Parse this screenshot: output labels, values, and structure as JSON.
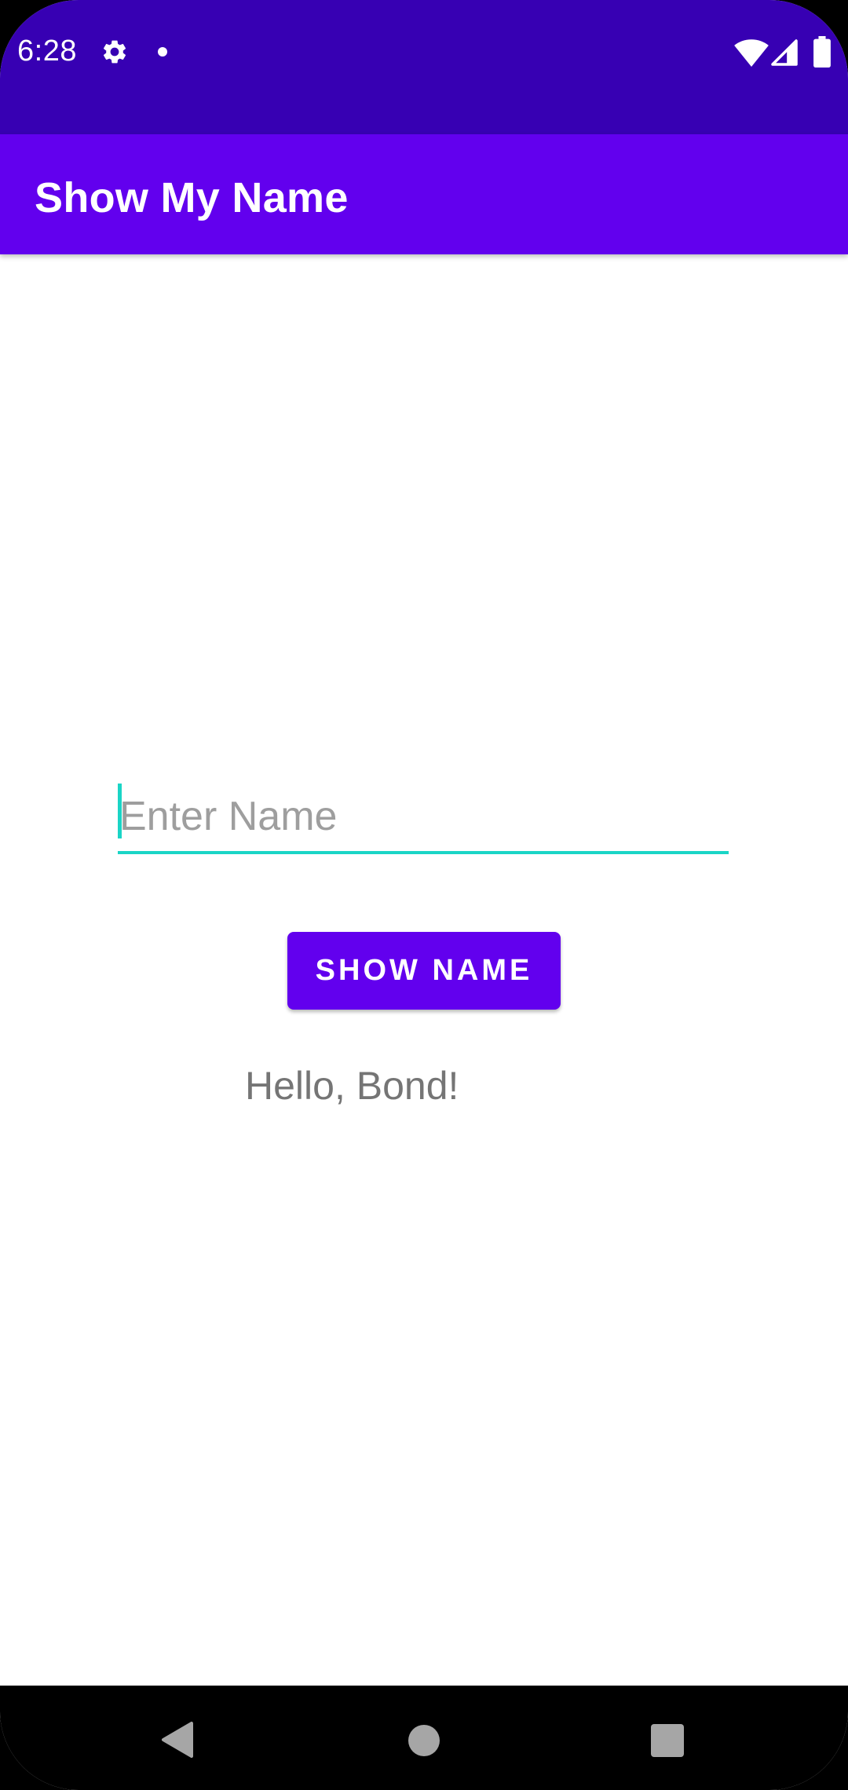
{
  "status_bar": {
    "time": "6:28",
    "background_color": "#3700b3",
    "icons": [
      "gear-icon",
      "notification-dot-icon",
      "wifi-icon",
      "signal-icon",
      "battery-icon"
    ]
  },
  "app_bar": {
    "title": "Show My Name",
    "background_color": "#6200ee"
  },
  "form": {
    "name_input": {
      "value": "",
      "placeholder": "Enter Name",
      "accent_color": "#1ad5c6"
    },
    "show_button_label": "SHOW NAME",
    "greeting_text": "Hello, Bond!"
  },
  "nav_bar": {
    "buttons": [
      "back-icon",
      "home-icon",
      "recents-icon"
    ]
  }
}
